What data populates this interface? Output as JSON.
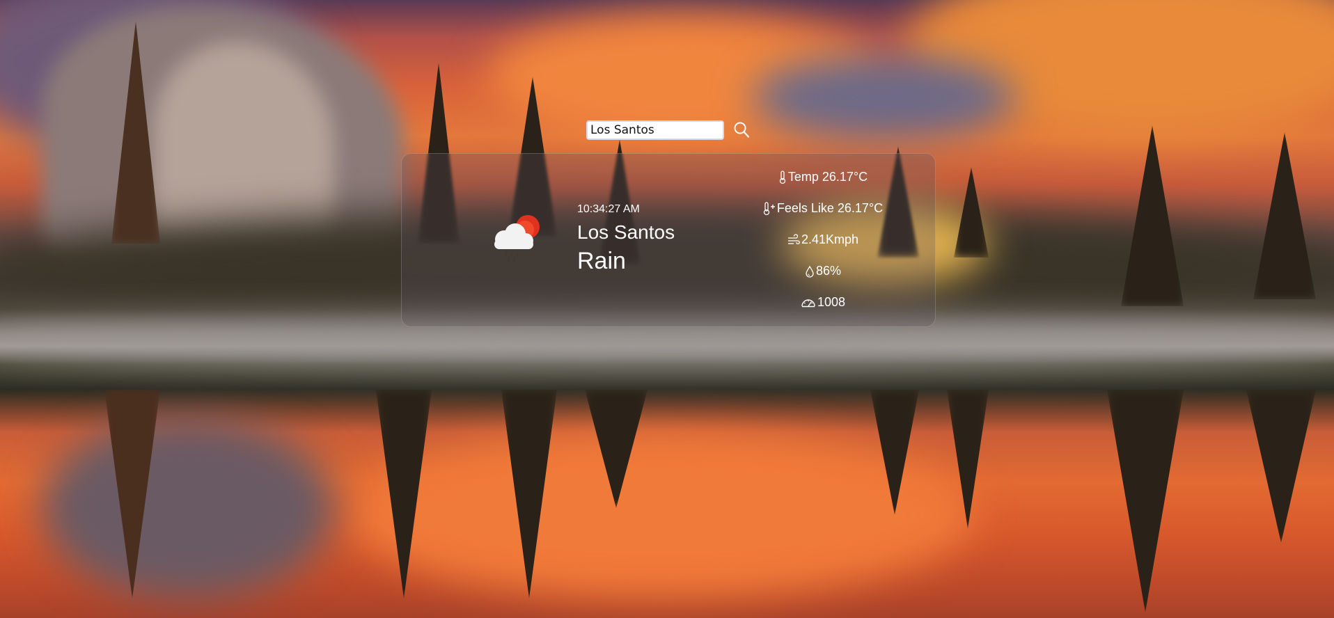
{
  "search": {
    "value": "Los Santos"
  },
  "weather": {
    "icon": "cloud-rain-sun-icon",
    "time": "10:34:27 AM",
    "city": "Los Santos",
    "condition": "Rain"
  },
  "stats": {
    "temp": "Temp 26.17°C",
    "feels_like": "Feels Like 26.17°C",
    "wind": "2.41Kmph",
    "humidity": "86%",
    "pressure": "1008"
  },
  "icons": {
    "search": "search-icon",
    "thermometer": "thermometer-icon",
    "feels_like": "thermometer-plus-icon",
    "wind": "wind-icon",
    "humidity": "droplet-icon",
    "pressure": "gauge-icon"
  },
  "colors": {
    "sun": "#e0331f",
    "cloud": "#f2f2f2",
    "text": "#ffffff"
  }
}
